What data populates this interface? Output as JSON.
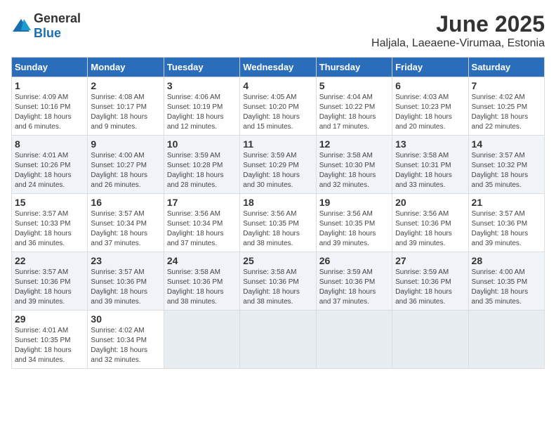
{
  "logo": {
    "general": "General",
    "blue": "Blue"
  },
  "title": "June 2025",
  "subtitle": "Haljala, Laeaene-Virumaa, Estonia",
  "days_header": [
    "Sunday",
    "Monday",
    "Tuesday",
    "Wednesday",
    "Thursday",
    "Friday",
    "Saturday"
  ],
  "weeks": [
    [
      {
        "day": "1",
        "sunrise": "Sunrise: 4:09 AM",
        "sunset": "Sunset: 10:16 PM",
        "daylight": "Daylight: 18 hours and 6 minutes."
      },
      {
        "day": "2",
        "sunrise": "Sunrise: 4:08 AM",
        "sunset": "Sunset: 10:17 PM",
        "daylight": "Daylight: 18 hours and 9 minutes."
      },
      {
        "day": "3",
        "sunrise": "Sunrise: 4:06 AM",
        "sunset": "Sunset: 10:19 PM",
        "daylight": "Daylight: 18 hours and 12 minutes."
      },
      {
        "day": "4",
        "sunrise": "Sunrise: 4:05 AM",
        "sunset": "Sunset: 10:20 PM",
        "daylight": "Daylight: 18 hours and 15 minutes."
      },
      {
        "day": "5",
        "sunrise": "Sunrise: 4:04 AM",
        "sunset": "Sunset: 10:22 PM",
        "daylight": "Daylight: 18 hours and 17 minutes."
      },
      {
        "day": "6",
        "sunrise": "Sunrise: 4:03 AM",
        "sunset": "Sunset: 10:23 PM",
        "daylight": "Daylight: 18 hours and 20 minutes."
      },
      {
        "day": "7",
        "sunrise": "Sunrise: 4:02 AM",
        "sunset": "Sunset: 10:25 PM",
        "daylight": "Daylight: 18 hours and 22 minutes."
      }
    ],
    [
      {
        "day": "8",
        "sunrise": "Sunrise: 4:01 AM",
        "sunset": "Sunset: 10:26 PM",
        "daylight": "Daylight: 18 hours and 24 minutes."
      },
      {
        "day": "9",
        "sunrise": "Sunrise: 4:00 AM",
        "sunset": "Sunset: 10:27 PM",
        "daylight": "Daylight: 18 hours and 26 minutes."
      },
      {
        "day": "10",
        "sunrise": "Sunrise: 3:59 AM",
        "sunset": "Sunset: 10:28 PM",
        "daylight": "Daylight: 18 hours and 28 minutes."
      },
      {
        "day": "11",
        "sunrise": "Sunrise: 3:59 AM",
        "sunset": "Sunset: 10:29 PM",
        "daylight": "Daylight: 18 hours and 30 minutes."
      },
      {
        "day": "12",
        "sunrise": "Sunrise: 3:58 AM",
        "sunset": "Sunset: 10:30 PM",
        "daylight": "Daylight: 18 hours and 32 minutes."
      },
      {
        "day": "13",
        "sunrise": "Sunrise: 3:58 AM",
        "sunset": "Sunset: 10:31 PM",
        "daylight": "Daylight: 18 hours and 33 minutes."
      },
      {
        "day": "14",
        "sunrise": "Sunrise: 3:57 AM",
        "sunset": "Sunset: 10:32 PM",
        "daylight": "Daylight: 18 hours and 35 minutes."
      }
    ],
    [
      {
        "day": "15",
        "sunrise": "Sunrise: 3:57 AM",
        "sunset": "Sunset: 10:33 PM",
        "daylight": "Daylight: 18 hours and 36 minutes."
      },
      {
        "day": "16",
        "sunrise": "Sunrise: 3:57 AM",
        "sunset": "Sunset: 10:34 PM",
        "daylight": "Daylight: 18 hours and 37 minutes."
      },
      {
        "day": "17",
        "sunrise": "Sunrise: 3:56 AM",
        "sunset": "Sunset: 10:34 PM",
        "daylight": "Daylight: 18 hours and 37 minutes."
      },
      {
        "day": "18",
        "sunrise": "Sunrise: 3:56 AM",
        "sunset": "Sunset: 10:35 PM",
        "daylight": "Daylight: 18 hours and 38 minutes."
      },
      {
        "day": "19",
        "sunrise": "Sunrise: 3:56 AM",
        "sunset": "Sunset: 10:35 PM",
        "daylight": "Daylight: 18 hours and 39 minutes."
      },
      {
        "day": "20",
        "sunrise": "Sunrise: 3:56 AM",
        "sunset": "Sunset: 10:36 PM",
        "daylight": "Daylight: 18 hours and 39 minutes."
      },
      {
        "day": "21",
        "sunrise": "Sunrise: 3:57 AM",
        "sunset": "Sunset: 10:36 PM",
        "daylight": "Daylight: 18 hours and 39 minutes."
      }
    ],
    [
      {
        "day": "22",
        "sunrise": "Sunrise: 3:57 AM",
        "sunset": "Sunset: 10:36 PM",
        "daylight": "Daylight: 18 hours and 39 minutes."
      },
      {
        "day": "23",
        "sunrise": "Sunrise: 3:57 AM",
        "sunset": "Sunset: 10:36 PM",
        "daylight": "Daylight: 18 hours and 39 minutes."
      },
      {
        "day": "24",
        "sunrise": "Sunrise: 3:58 AM",
        "sunset": "Sunset: 10:36 PM",
        "daylight": "Daylight: 18 hours and 38 minutes."
      },
      {
        "day": "25",
        "sunrise": "Sunrise: 3:58 AM",
        "sunset": "Sunset: 10:36 PM",
        "daylight": "Daylight: 18 hours and 38 minutes."
      },
      {
        "day": "26",
        "sunrise": "Sunrise: 3:59 AM",
        "sunset": "Sunset: 10:36 PM",
        "daylight": "Daylight: 18 hours and 37 minutes."
      },
      {
        "day": "27",
        "sunrise": "Sunrise: 3:59 AM",
        "sunset": "Sunset: 10:36 PM",
        "daylight": "Daylight: 18 hours and 36 minutes."
      },
      {
        "day": "28",
        "sunrise": "Sunrise: 4:00 AM",
        "sunset": "Sunset: 10:35 PM",
        "daylight": "Daylight: 18 hours and 35 minutes."
      }
    ],
    [
      {
        "day": "29",
        "sunrise": "Sunrise: 4:01 AM",
        "sunset": "Sunset: 10:35 PM",
        "daylight": "Daylight: 18 hours and 34 minutes."
      },
      {
        "day": "30",
        "sunrise": "Sunrise: 4:02 AM",
        "sunset": "Sunset: 10:34 PM",
        "daylight": "Daylight: 18 hours and 32 minutes."
      },
      {
        "day": "",
        "sunrise": "",
        "sunset": "",
        "daylight": ""
      },
      {
        "day": "",
        "sunrise": "",
        "sunset": "",
        "daylight": ""
      },
      {
        "day": "",
        "sunrise": "",
        "sunset": "",
        "daylight": ""
      },
      {
        "day": "",
        "sunrise": "",
        "sunset": "",
        "daylight": ""
      },
      {
        "day": "",
        "sunrise": "",
        "sunset": "",
        "daylight": ""
      }
    ]
  ]
}
